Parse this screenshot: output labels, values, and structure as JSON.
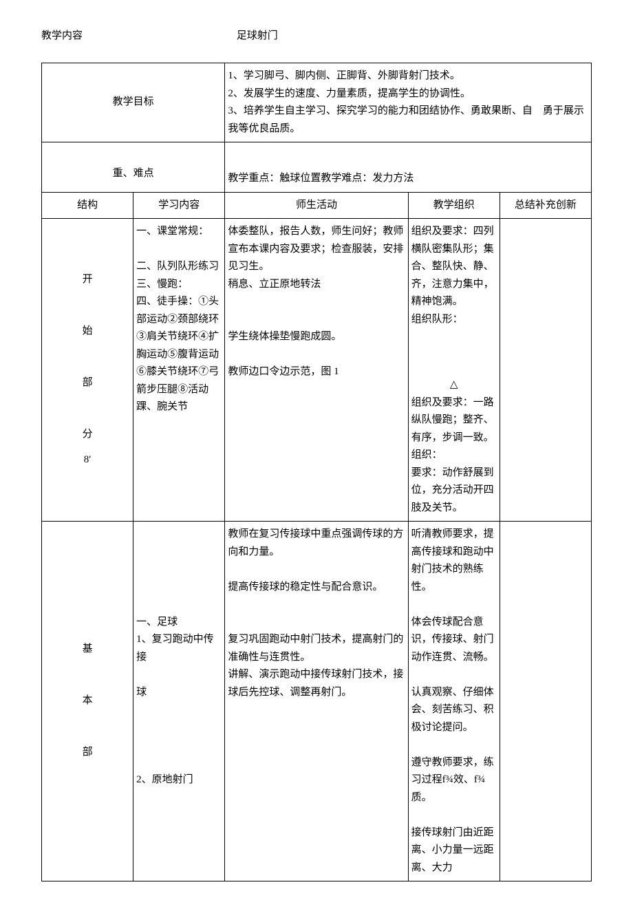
{
  "header": {
    "label": "教学内容",
    "title": "足球射门"
  },
  "rows": {
    "goal_label": "教学目标",
    "goal_text": "1、学习脚弓、脚内侧、正脚背、外脚背射门技术。\n2、发展学生的速度、力量素质，提高学生的协调性。\n3、培养学生自主学习、探究学习的能力和团结协作、勇敢果断、自 勇于展示我等优良品质。",
    "keypoint_label": "重、难点",
    "keypoint_text": "教学重点：触球位置教学难点：发力方法",
    "col_structure": "结构",
    "col_content": "学习内容",
    "col_activity": "师生活动",
    "col_org": "教学组织",
    "col_summary": "总结补充创新",
    "start_label": "开\n\n始\n\n部\n\n分\n8ʹ",
    "start_content": "一、课堂常规：\n\n二、队列队形练习三、慢跑：\n四、徒手操：①头部运动②颈部绕环③肩关节绕环④扩胸运动⑤腹背运动⑥膝关节绕环⑦弓箭步压腿⑧活动踝、腕关节",
    "start_activity": "体委整队，报告人数，师生问好；教师宣布本课内容及要求；检查服装，安排见习生。\n稍息、立正原地转法\n\n\n学生绕体操垫慢跑成圆。\n\n教师边口令边示范，图 1",
    "start_org": "组织及要求：四列横队密集队形；集合、整队快、静、齐，注意力集中，精神饱满。\n组织队形：",
    "start_org_triangle": "△",
    "start_org2": "组织及要求：一路纵队慢跑；整齐、有序，步调一致。\n组织：\n要求：动作舒展到位，充分活动开四肢及关节。",
    "basic_label": "基\n\n本\n\n部",
    "basic_content": "一、足球\n1、复习跑动中传接\n\n球\n\n\n\n\n2、原地射门",
    "basic_activity": "教师在复习传接球中重点强调传球的方向和力量。\n\n提高传接球的稳定性与配合意识。\n\n\n复习巩固跑动中射门技术，提高射门的准确性与连贯性。\n讲解、演示跑动中接传球射门技术，接球后先控球、调整再射门。",
    "basic_org": "听清教师要求，提高传接球和跑动中射门技术的熟练性。\n\n体会传球配合意识，传接球、射门动作连贯、流畅。\n\n认真观察、仔细体会、刻苦练习、积极讨论提问。\n\n遵守教师要求，练习过程f¾效、f¾质。\n\n接传球射门由近距离、小力量一远距离、大力"
  }
}
